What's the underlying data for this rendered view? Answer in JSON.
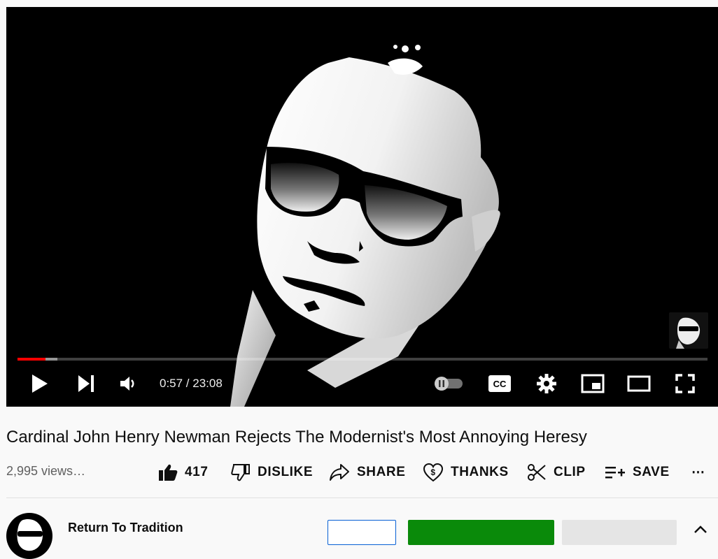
{
  "player": {
    "current_time": "0:57",
    "duration": "23:08",
    "time_display": "0:57 / 23:08",
    "played_fraction": 0.041,
    "buffered_fraction": 0.058,
    "controls": [
      "play-icon",
      "next-icon",
      "volume-icon",
      "autoplay-toggle",
      "captions-icon",
      "settings-icon",
      "miniplayer-icon",
      "theater-icon",
      "fullscreen-icon"
    ],
    "progress_color": "#ff0000"
  },
  "video": {
    "title": "Cardinal John Henry Newman Rejects The Modernist's Most Annoying Heresy",
    "views": "2,995 views…"
  },
  "actions": {
    "like_count": "417",
    "dislike_label": "DISLIKE",
    "share_label": "SHARE",
    "thanks_label": "THANKS",
    "clip_label": "CLIP",
    "save_label": "SAVE",
    "more_label": "⋯"
  },
  "channel": {
    "name": "Return To Tradition",
    "subscribe_color": "#0a8a0a",
    "join_border_color": "#065fd4"
  }
}
